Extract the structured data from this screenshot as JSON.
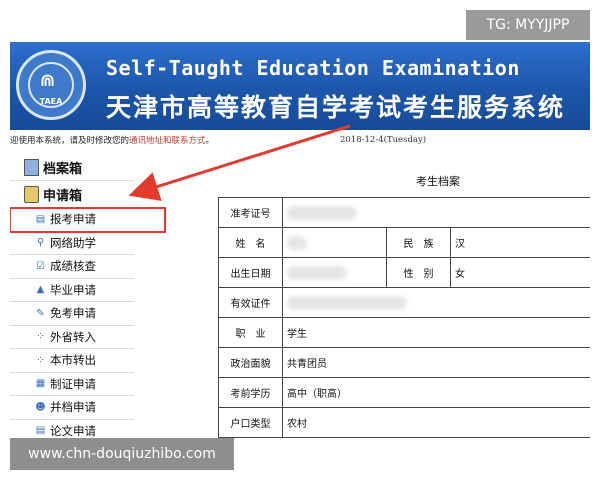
{
  "watermark_top": "TG: MYYJJPP",
  "watermark_bottom": "www.chn-douqiuzhibo.com",
  "banner": {
    "logo_text": "TAEA",
    "title_en": "Self-Taught Education Examination",
    "title_cn": "天津市高等教育自学考试考生服务系统"
  },
  "notice": {
    "prefix": "迎使用本系统，请及时修改您的",
    "link": "通讯地址和联系方式",
    "suffix": "。"
  },
  "date": "2018-12-4(Tuesday)",
  "sidebar": {
    "archive": "档案箱",
    "application": "申请箱",
    "items": [
      {
        "label": "报考申请",
        "icon": "form-icon"
      },
      {
        "label": "网络助学",
        "icon": "network-icon"
      },
      {
        "label": "成绩核查",
        "icon": "check-icon"
      },
      {
        "label": "毕业申请",
        "icon": "grad-cap-icon"
      },
      {
        "label": "免考申请",
        "icon": "pencil-icon"
      },
      {
        "label": "外省转入",
        "icon": "transfer-in-icon"
      },
      {
        "label": "本市转出",
        "icon": "transfer-out-icon"
      },
      {
        "label": "制证申请",
        "icon": "certificate-icon"
      },
      {
        "label": "并档申请",
        "icon": "merge-user-icon"
      },
      {
        "label": "论文申请",
        "icon": "paper-icon"
      }
    ]
  },
  "profile": {
    "title": "考生档案",
    "rows": [
      {
        "label": "准考证号",
        "value": ""
      },
      {
        "label": "姓　名",
        "value": "",
        "label2": "民　族",
        "value2": "汉"
      },
      {
        "label": "出生日期",
        "value": "",
        "label2": "性　别",
        "value2": "女"
      },
      {
        "label": "有效证件",
        "value": ""
      },
      {
        "label": "职　业",
        "value": "学生"
      },
      {
        "label": "政治面貌",
        "value": "共青团员"
      },
      {
        "label": "考前学历",
        "value": "高中（职高）"
      },
      {
        "label": "户口类型",
        "value": "农村"
      }
    ]
  },
  "colors": {
    "banner": "#1f5db4",
    "highlight": "#e23b2e",
    "link": "#c0392b"
  }
}
